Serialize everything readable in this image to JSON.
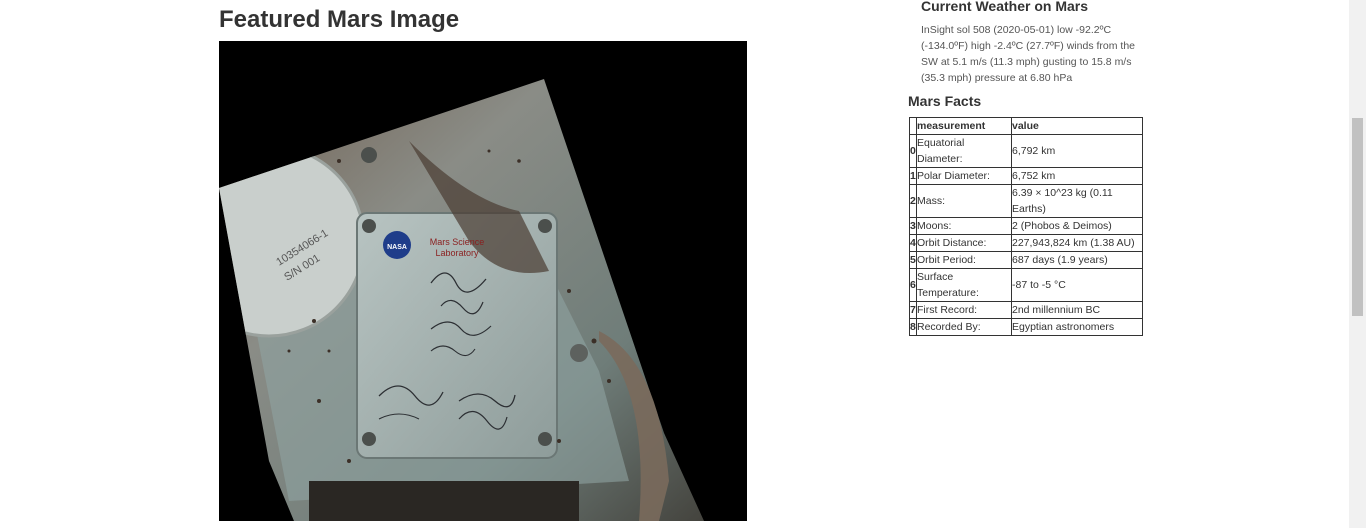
{
  "featured": {
    "title": "Featured Mars Image",
    "image_labels": {
      "nasa": "NASA",
      "lab_line1": "Mars Science",
      "lab_line2": "Laboratory",
      "serial_line1": "10354066-1",
      "serial_line2": "S/N 001"
    }
  },
  "weather": {
    "title": "Current Weather on Mars",
    "text": "InSight sol 508 (2020-05-01) low -92.2ºC (-134.0ºF) high -2.4ºC (27.7ºF) winds from the SW at 5.1 m/s (11.3 mph) gusting to 15.8 m/s (35.3 mph) pressure at 6.80 hPa"
  },
  "facts": {
    "title": "Mars Facts",
    "header_index": "",
    "header_measurement": "measurement",
    "header_value": "value",
    "rows": [
      {
        "index": "0",
        "measurement": "Equatorial Diameter:",
        "value": "6,792 km"
      },
      {
        "index": "1",
        "measurement": "Polar Diameter:",
        "value": "6,752 km"
      },
      {
        "index": "2",
        "measurement": "Mass:",
        "value": "6.39 × 10^23 kg (0.11 Earths)"
      },
      {
        "index": "3",
        "measurement": "Moons:",
        "value": "2 (Phobos & Deimos)"
      },
      {
        "index": "4",
        "measurement": "Orbit Distance:",
        "value": "227,943,824 km (1.38 AU)"
      },
      {
        "index": "5",
        "measurement": "Orbit Period:",
        "value": "687 days (1.9 years)"
      },
      {
        "index": "6",
        "measurement": "Surface Temperature:",
        "value": "-87 to -5 °C"
      },
      {
        "index": "7",
        "measurement": "First Record:",
        "value": "2nd millennium BC"
      },
      {
        "index": "8",
        "measurement": "Recorded By:",
        "value": "Egyptian astronomers"
      }
    ]
  }
}
